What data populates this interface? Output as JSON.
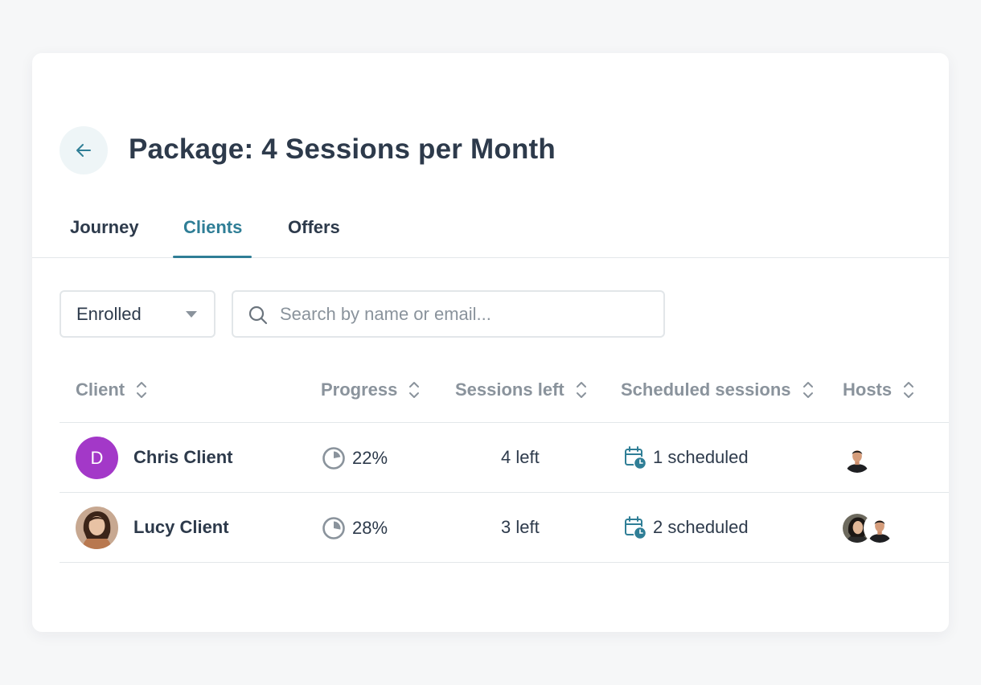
{
  "page": {
    "title": "Package: 4 Sessions per Month"
  },
  "tabs": [
    {
      "label": "Journey",
      "active": false
    },
    {
      "label": "Clients",
      "active": true
    },
    {
      "label": "Offers",
      "active": false
    }
  ],
  "filters": {
    "status_selected": "Enrolled",
    "search_placeholder": "Search by name or email...",
    "search_value": ""
  },
  "table": {
    "columns": [
      {
        "key": "client",
        "label": "Client"
      },
      {
        "key": "progress",
        "label": "Progress"
      },
      {
        "key": "sessions_left",
        "label": "Sessions left"
      },
      {
        "key": "scheduled",
        "label": "Scheduled sessions"
      },
      {
        "key": "hosts",
        "label": "Hosts"
      }
    ],
    "rows": [
      {
        "client_name": "Chris Client",
        "avatar_initial": "D",
        "avatar_color": "#a338c8",
        "progress": "22%",
        "progress_value": 0.22,
        "sessions_left": "4 left",
        "scheduled": "1 scheduled",
        "host_count": 1
      },
      {
        "client_name": "Lucy Client",
        "avatar_initial": "",
        "avatar_color": "",
        "progress": "28%",
        "progress_value": 0.28,
        "sessions_left": "3 left",
        "scheduled": "2 scheduled",
        "host_count": 2
      }
    ]
  },
  "colors": {
    "accent": "#2f7e96",
    "heading": "#2d3a4b",
    "muted": "#8a939c",
    "avatar_purple": "#a338c8"
  },
  "icons": {
    "back": "arrow-left-icon",
    "dropdown": "caret-down-icon",
    "search": "search-icon",
    "sort": "sort-icon",
    "progress": "pie-progress-icon",
    "calendar": "calendar-clock-icon"
  }
}
